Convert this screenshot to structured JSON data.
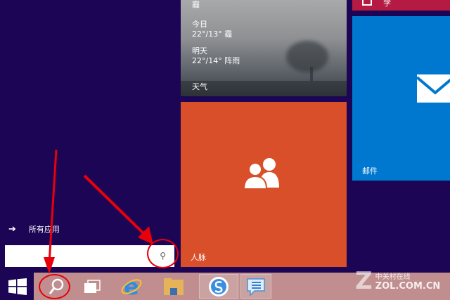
{
  "tiles": {
    "weather": {
      "top_partial": "霾",
      "today_label": "今日",
      "today_value": "22°/13° 霾",
      "tomorrow_label": "明天",
      "tomorrow_value": "22°/14° 阵雨",
      "label": "天气"
    },
    "red_tile": {
      "label_partial": "学"
    },
    "mail": {
      "label": "邮件"
    },
    "people": {
      "label": "人脉"
    }
  },
  "start": {
    "all_apps": "所有应用",
    "search_placeholder": ""
  },
  "watermark": {
    "cn": "中关村在线",
    "en": "ZOL.COM.CN"
  },
  "colors": {
    "background": "#1b0554",
    "taskbar": "#c08e8e",
    "people": "#d84f2a",
    "mail": "#0078cf",
    "annotation": "#e8000a"
  }
}
